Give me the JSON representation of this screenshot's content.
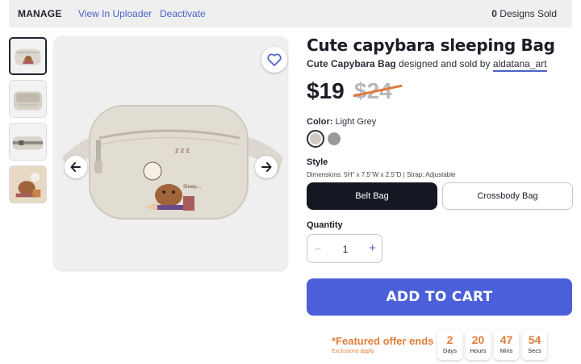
{
  "topbar": {
    "manage": "MANAGE",
    "view_uploader": "View In Uploader",
    "deactivate": "Deactivate",
    "sold_count": "0",
    "sold_label": "Designs Sold"
  },
  "product": {
    "title": "Cute capybara sleeping Bag",
    "design_name": "Cute Capybara Bag",
    "byline_text": "designed and sold by",
    "artist": "aldatana_art",
    "price": "$19",
    "old_price": "$24"
  },
  "color": {
    "label": "Color:",
    "selected": "Light Grey",
    "swatches": [
      "#cfcac2",
      "#9a9a9a"
    ]
  },
  "style": {
    "label": "Style",
    "dimensions": "Dimensions: 5H\" x 7.5\"W x 2.5\"D | Strap: Adjustable",
    "options": [
      "Belt Bag",
      "Crossbody Bag"
    ]
  },
  "quantity": {
    "label": "Quantity",
    "minus": "−",
    "value": "1",
    "plus": "+"
  },
  "cart": {
    "label": "ADD TO CART"
  },
  "offer": {
    "label": "*Featured offer ends",
    "sub": "Exclusions apply.",
    "timer": [
      {
        "value": "2",
        "unit": "Days"
      },
      {
        "value": "20",
        "unit": "Hours"
      },
      {
        "value": "47",
        "unit": "Mins"
      },
      {
        "value": "54",
        "unit": "Secs"
      }
    ]
  },
  "colors": {
    "accent": "#4a5fd8",
    "offer": "#e27d3b",
    "dark": "#151722"
  },
  "icons": [
    "heart-icon",
    "arrow-left-icon",
    "arrow-right-icon"
  ]
}
